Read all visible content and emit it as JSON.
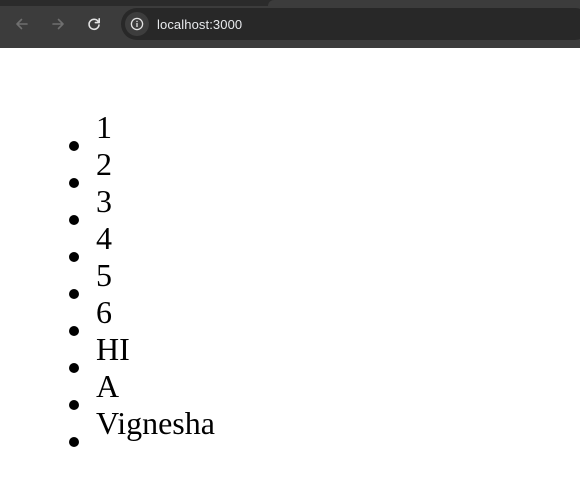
{
  "browser": {
    "url": "localhost:3000",
    "back_icon": "arrow-left-icon",
    "forward_icon": "arrow-right-icon",
    "reload_icon": "reload-icon",
    "site_info_icon": "info-icon"
  },
  "list": {
    "items": [
      "1",
      "2",
      "3",
      "4",
      "5",
      "6",
      "HI",
      "A",
      "Vignesha"
    ]
  },
  "colors": {
    "chrome_bg": "#3c3c3c",
    "omnibox_bg": "#282828",
    "page_bg": "#ffffff",
    "text": "#000000"
  }
}
